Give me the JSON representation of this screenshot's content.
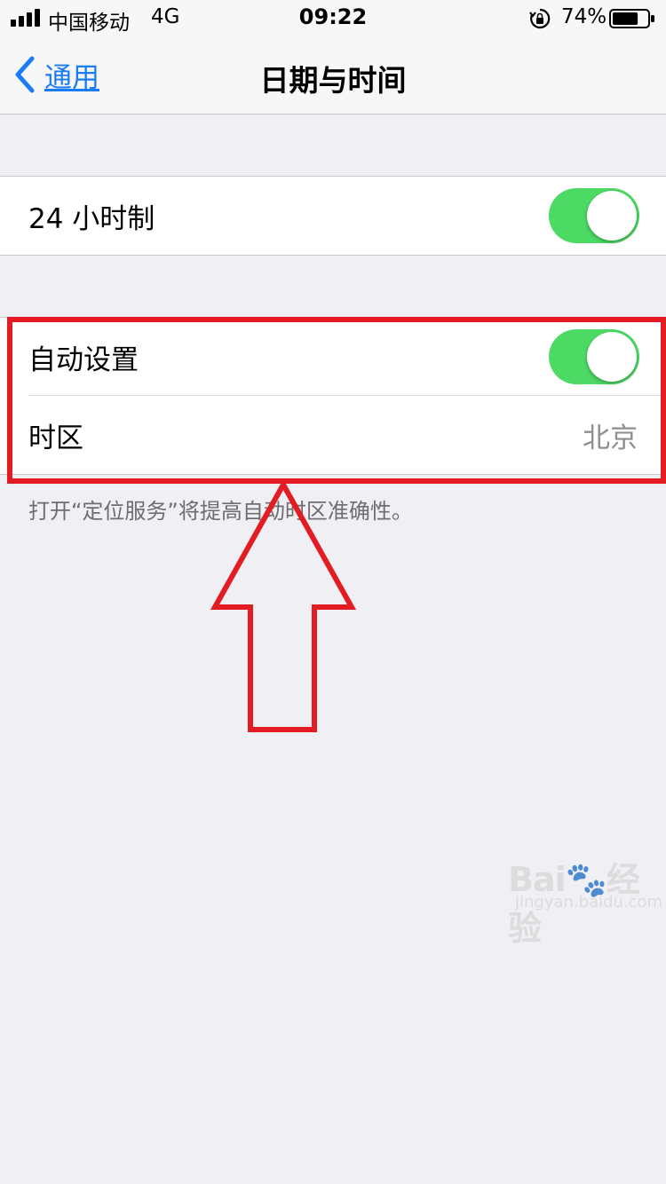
{
  "status_bar": {
    "carrier": "中国移动",
    "network": "4G",
    "time": "09:22",
    "battery_percent": "74%",
    "battery_level": 0.74,
    "icons": [
      "signal-icon",
      "orientation-lock-icon",
      "battery-icon"
    ]
  },
  "nav": {
    "back_label": "通用",
    "title": "日期与时间",
    "accent_color": "#1a7cf5"
  },
  "group1": {
    "clock_24h_label": "24 小时制",
    "clock_24h_on": true
  },
  "group2": {
    "auto_set_label": "自动设置",
    "auto_set_on": true,
    "timezone_label": "时区",
    "timezone_value": "北京"
  },
  "footer_note": "打开“定位服务”将提高自动时区准确性。",
  "colors": {
    "toggle_on": "#4cd964",
    "annotation_red": "#e31b23",
    "background": "#efeff4"
  },
  "watermark": {
    "brand": "Bai",
    "brand_suffix": "经验",
    "url": "jingyan.baidu.com"
  }
}
